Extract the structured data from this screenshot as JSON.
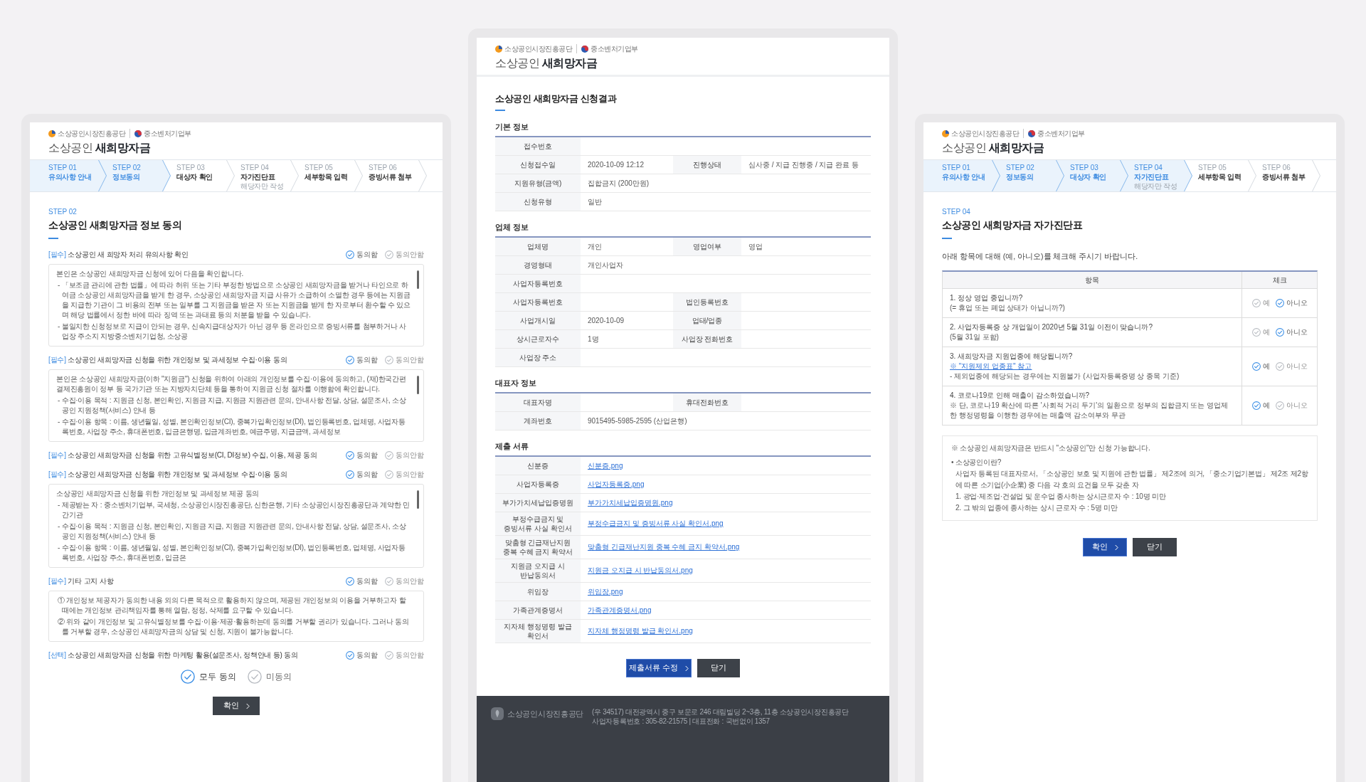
{
  "screens": [
    {
      "kind": "consent",
      "header": {
        "logos": [
          {
            "kind": "agency",
            "text": "소상공인시장진흥공단"
          },
          {
            "kind": "ministry",
            "text": "중소벤처기업부"
          }
        ],
        "brand": "소상공인 **새희망자금**"
      },
      "steps": [
        {
          "number": "STEP 01",
          "label": "유의사항 안내",
          "active": true
        },
        {
          "number": "STEP 02",
          "label": "정보동의",
          "active": true
        },
        {
          "number": "STEP 03",
          "label": "대상자 확인",
          "active": false
        },
        {
          "number": "STEP 04",
          "label": "자가진단표",
          "note": "해당자만 작성",
          "active": false
        },
        {
          "number": "STEP 05",
          "label": "세부항목 입력",
          "active": false
        },
        {
          "number": "STEP 06",
          "label": "증빙서류 첨부",
          "active": false
        }
      ],
      "eyebrow": "STEP 02",
      "title": "소상공인 새희망자금 정보 동의",
      "sections": [
        {
          "tag": "[필수]",
          "title": "소상공인 새 희망자 처리 유의사항 확인",
          "options": [
            {
              "label": "동의함",
              "selected": true
            },
            {
              "label": "동의안함",
              "selected": false
            }
          ],
          "scrollable": true,
          "paragraphs": [
            {
              "kind": "lead",
              "text": "본인은 소상공인 새희망자금 신청에 있어 다음을 확인합니다."
            },
            {
              "kind": "item",
              "text": "- 「보조금 관리에 관한 법률」에 따라 허위 또는 기타 부정한 방법으로 소상공인 새희망자금을 받거나 타인으로 하여금 소상공인 새희망자금을 받게 한 경우, 소상공인 새희망자금 지급 사유가 소급하여 소멸한 경우 등에는 지원금을 지급한 기관이 그 비용의 전부 또는 일부를 그 지원금을 받은 자 또는 지원금을 받게 한 자로부터 환수할 수 있으며 해당 법률에서 정한 바에 따라 징역 또는 과태료 등의 처분을 받을 수 있습니다."
            },
            {
              "kind": "item",
              "text": "- 불일치한 신청정보로 지급이 안되는 경우, 신속지급대상자가 아닌 경우 등 온라인으로 증빙서류를 첨부하거나 사업장 주소지 지방중소벤처기업청, 소상공"
            }
          ]
        },
        {
          "tag": "[필수]",
          "title": "소상공인 새희망자금 신청을 위한 개인정보 및 과세정보 수집·이용 동의",
          "options": [
            {
              "label": "동의함",
              "selected": true
            },
            {
              "label": "동의안함",
              "selected": false
            }
          ],
          "scrollable": true,
          "paragraphs": [
            {
              "kind": "lead",
              "text": "본인은 소상공인 새희망자금(이하 \"지원금\") 신청을 위하여 아래의 개인정보를 수집·이용에 동의하고, (재)한국간편결제진흥원이 정부 등 국가기관 또는 지방자치단체 등을 통하여 지원금 신청 절차를 이행함에 확인합니다."
            },
            {
              "kind": "item",
              "text": "- 수집·이용 목적 : 지원금 신청, 본인확인, 지원금 지급, 지원금 지원관련 문의, 안내사항 전달, 상담, 설문조사, 소상공인 지원정책(서비스) 안내 등"
            },
            {
              "kind": "item",
              "text": "- 수집·이용 항목 : 이름, 생년월일, 성별, 본인확인정보(CI), 중복가입확인정보(DI), 법인등록번호, 업체명, 사업자등록번호, 사업장 주소, 휴대폰번호, 입금은행명, 입금계좌번호, 예금주명, 지급금액, 과세정보"
            }
          ]
        },
        {
          "tag": "[필수]",
          "title": "소상공인 새희망자금 신청을 위한 고유식별정보(CI, DI정보) 수집, 이용, 제공 동의",
          "options": [
            {
              "label": "동의함",
              "selected": true
            },
            {
              "label": "동의안함",
              "selected": false
            }
          ]
        },
        {
          "tag": "[필수]",
          "title": "소상공인 새희망자금 신청을 위한 개인정보 및 과세정보 수집·이용 동의",
          "options": [
            {
              "label": "동의함",
              "selected": true
            },
            {
              "label": "동의안함",
              "selected": false
            }
          ],
          "scrollable": true,
          "paragraphs": [
            {
              "kind": "lead",
              "text": "소상공인 새희망자금 신청을 위한 개인정보 및 과세정보 제공 동의"
            },
            {
              "kind": "item",
              "text": "- 제공받는 자 : 중소벤처기업부, 국세청, 소상공인시장진흥공단, 신한은행, 기타 소상공인시장진흥공단과 계약한 민간기관"
            },
            {
              "kind": "item",
              "text": "- 수집·이용 목적 : 지원금 신청, 본인확인, 지원금 지급, 지원금 지원관련 문의, 안내사항 전달, 상담, 설문조사, 소상공인 지원정책(서비스) 안내 등"
            },
            {
              "kind": "item",
              "text": "- 수집·이용 항목 : 이름, 생년월일, 성별, 본인확인정보(CI), 중복가입확인정보(DI), 법인등록번호, 업체명, 사업자등록번호, 사업장 주소, 휴대폰번호, 입금은"
            }
          ]
        },
        {
          "tag": "[필수]",
          "title": "기타 고지 사항",
          "options": [
            {
              "label": "동의함",
              "selected": true
            },
            {
              "label": "동의안함",
              "selected": false
            }
          ],
          "scrollable": false,
          "paragraphs": [
            {
              "kind": "item",
              "text": "① 개인정보 제공자가 동의한 내용 외의 다른 목적으로 활용하지 않으며, 제공된 개인정보의 이용을 거부하고자 할 때에는 개인정보 관리책임자를 통해 열람, 정정, 삭제를 요구할 수 있습니다."
            },
            {
              "kind": "item",
              "text": "② 위와 같이 개인정보 및 고유식별정보를 수집·이용·제공·활용하는데 동의를 거부할 권리가 있습니다. 그러나 동의를 거부할 경우, 소상공인 새희망자금의 상담 및 신청, 지원이 불가능합니다."
            }
          ]
        },
        {
          "tag": "[선택]",
          "title": "소상공인 새희망자금 신청을 위한 마케팅 활용(설문조사, 정책안내 등) 동의",
          "options": [
            {
              "label": "동의함",
              "selected": true
            },
            {
              "label": "동의안함",
              "selected": false
            }
          ]
        }
      ],
      "agree_all": [
        {
          "label": "모두 동의",
          "selected": true
        },
        {
          "label": "미동의",
          "selected": false
        }
      ],
      "buttons": [
        {
          "label": "확인",
          "kind": "next"
        }
      ]
    },
    {
      "kind": "result",
      "header": {
        "logos": [
          {
            "kind": "agency",
            "text": "소상공인시장진흥공단"
          },
          {
            "kind": "ministry",
            "text": "중소벤처기업부"
          }
        ],
        "brand": "소상공인 **새희망자금**"
      },
      "title": "소상공인 새희망자금 신청결과",
      "sections": [
        {
          "heading": "기본 정보",
          "rows": [
            {
              "fields": [
                {
                  "label": "접수번호"
                }
              ]
            },
            {
              "fields": [
                {
                  "label": "신청접수일",
                  "value": "2020-10-09 12:12"
                },
                {
                  "label": "진행상태",
                  "value": "심사중 / 지급 진행중 / 지급 완료 등"
                }
              ]
            },
            {
              "fields": [
                {
                  "label": "지원유형(금액)",
                  "value": "집합금지 (200만원)"
                }
              ]
            },
            {
              "fields": [
                {
                  "label": "신청유형",
                  "value": "일반"
                }
              ]
            }
          ]
        },
        {
          "heading": "업체 정보",
          "rows": [
            {
              "fields": [
                {
                  "label": "업체명",
                  "value": "개인"
                },
                {
                  "label": "영업여부",
                  "value": "영업"
                }
              ]
            },
            {
              "fields": [
                {
                  "label": "경영형태",
                  "value": "개인사업자"
                }
              ]
            },
            {
              "fields": [
                {
                  "label": "사업자등록번호"
                }
              ]
            },
            {
              "fields": [
                {
                  "label": "사업자등록번호"
                },
                {
                  "label": "법인등록번호"
                }
              ]
            },
            {
              "fields": [
                {
                  "label": "사업개시일",
                  "value": "2020-10-09"
                },
                {
                  "label": "업태/업종"
                }
              ]
            },
            {
              "fields": [
                {
                  "label": "상시근로자수",
                  "value": "1명"
                },
                {
                  "label": "사업장 전화번호"
                }
              ]
            },
            {
              "fields": [
                {
                  "label": "사업장 주소"
                }
              ]
            }
          ]
        },
        {
          "heading": "대표자 정보",
          "rows": [
            {
              "fields": [
                {
                  "label": "대표자명"
                },
                {
                  "label": "휴대전화번호"
                }
              ]
            },
            {
              "fields": [
                {
                  "label": "계좌번호",
                  "value": "9015495-5985-2595 (산업은행)"
                }
              ]
            }
          ]
        },
        {
          "heading": "제출 서류",
          "rows": [
            {
              "fields": [
                {
                  "label": "신분증",
                  "link": "신분증.png"
                }
              ]
            },
            {
              "fields": [
                {
                  "label": "사업자등록증",
                  "link": "사업자등록증.png"
                }
              ]
            },
            {
              "fields": [
                {
                  "label": "부가가치세납입증명원",
                  "link": "부가가치세납입증명원.png"
                }
              ]
            },
            {
              "fields": [
                {
                  "label": "부정수급금지 및 증빙서류 사실 확인서",
                  "link": "부정수급금지 및 증빙서류 사실 확인서.png"
                }
              ]
            },
            {
              "fields": [
                {
                  "label": "맞춤형 긴급재난지원 중복 수혜 금지 확약서",
                  "link": "맞춤형 긴급재난지원 중복 수혜 금지 확약서.png"
                }
              ]
            },
            {
              "fields": [
                {
                  "label": "지원금 오지급 시 반납동의서",
                  "link": "지원금 오지급 시 반납동의서.png"
                }
              ]
            },
            {
              "fields": [
                {
                  "label": "위임장",
                  "link": "위임장.png"
                }
              ]
            },
            {
              "fields": [
                {
                  "label": "가족관계증명서",
                  "link": "가족관계증명서.png"
                }
              ]
            },
            {
              "fields": [
                {
                  "label": "지자체 행정명령 발급 확인서",
                  "link": "지자체 행정명령 발급 확인서.png"
                }
              ]
            }
          ]
        }
      ],
      "buttons": [
        {
          "label": "제출서류 수정",
          "kind": "edit"
        },
        {
          "label": "닫기",
          "kind": "close"
        }
      ],
      "footer": {
        "agency": "소상공인시장진흥공단",
        "address": [
          "(우 34517) 대전광역시 중구 보문로 246 대림빌딩 2~3층, 11층 소상공인시장진흥공단",
          "사업자등록번호 : 305-82-21575 | 대표전화 : 국번없이 1357"
        ]
      }
    },
    {
      "kind": "checklist",
      "header": {
        "logos": [
          {
            "kind": "agency",
            "text": "소상공인시장진흥공단"
          },
          {
            "kind": "ministry",
            "text": "중소벤처기업부"
          }
        ],
        "brand": "소상공인 **새희망자금**"
      },
      "steps": [
        {
          "number": "STEP 01",
          "label": "유의사항 안내",
          "active": true
        },
        {
          "number": "STEP 02",
          "label": "정보동의",
          "active": true
        },
        {
          "number": "STEP 03",
          "label": "대상자 확인",
          "active": true
        },
        {
          "number": "STEP 04",
          "label": "자가진단표",
          "note": "해당자만 작성",
          "active": true
        },
        {
          "number": "STEP 05",
          "label": "세부항목 입력",
          "active": false
        },
        {
          "number": "STEP 06",
          "label": "증빙서류 첨부",
          "active": false
        }
      ],
      "eyebrow": "STEP 04",
      "title": "소상공인 새희망자금 자가진단표",
      "instruction": "아래 항목에 대해 (예, 아니오)를 체크해 주시기 바랍니다.",
      "table": {
        "columns": [
          "항목",
          "체크"
        ],
        "rows": [
          {
            "lines": [
              {
                "kind": "question",
                "text": "1. 정상 영업 중입니까?"
              },
              {
                "kind": "note",
                "text": "(= 휴업 또는 폐업 상태가 아닙니까?)"
              }
            ],
            "options": [
              {
                "label": "예",
                "selected": false
              },
              {
                "label": "아니오",
                "selected": true
              }
            ]
          },
          {
            "lines": [
              {
                "kind": "question",
                "text": "2. 사업자등록증 상 개업일이 2020년 5월 31일 이전이 맞습니까?"
              },
              {
                "kind": "note",
                "text": "(5월 31일 포함)"
              }
            ],
            "options": [
              {
                "label": "예",
                "selected": false
              },
              {
                "label": "아니오",
                "selected": true
              }
            ]
          },
          {
            "lines": [
              {
                "kind": "question",
                "text": "3. 새희망자금 지원업종에 해당됩니까?"
              },
              {
                "kind": "link",
                "text": "※ \"지원제외 업종표\" 참고"
              },
              {
                "kind": "note",
                "text": "- 제외업종에 해당되는 경우에는 지원불가 (사업자등록증명 상 종목 기준)"
              }
            ],
            "options": [
              {
                "label": "예",
                "selected": true
              },
              {
                "label": "아니오",
                "selected": false
              }
            ]
          },
          {
            "lines": [
              {
                "kind": "question",
                "text": "4. 코로나19로 인해 매출이 감소하였습니까?"
              },
              {
                "kind": "note",
                "text": "※ 단, 코로나19 확산에 따른 '사회적 거리 두기'의 일환으로 정부의 집합금지 또는 영업제한 행정명령을 이행한 경우에는 매출액 감소여부와 무관"
              }
            ],
            "options": [
              {
                "label": "예",
                "selected": true
              },
              {
                "label": "아니오",
                "selected": false
              }
            ]
          }
        ]
      },
      "notes": [
        {
          "kind": "lead",
          "text": "※ 소상공인 새희망자금은 반드시 \"소상공인\"만 신청 가능합니다."
        },
        {
          "kind": "title",
          "text": "• 소상공인이란?"
        },
        {
          "kind": "indent",
          "text": "사업자 등록된 대표자로서, 「소상공인 보호 및 지원에 관한 법률」 제2조에 의거, 「중소기업기본법」 제2조 제2항에 따른 소기업(小企業) 중 다음 각 호의 요건을 모두 갖춘 자"
        },
        {
          "kind": "indent",
          "text": "1. 광업·제조업·건설업 및 운수업 종사하는 상시근로자 수 : 10명 미만"
        },
        {
          "kind": "indent",
          "text": "2. 그 밖의 업종에 종사하는 상시 근로자 수 : 5명 미만"
        }
      ],
      "buttons": [
        {
          "label": "확인",
          "kind": "confirm"
        },
        {
          "label": "닫기",
          "kind": "close"
        }
      ]
    }
  ]
}
